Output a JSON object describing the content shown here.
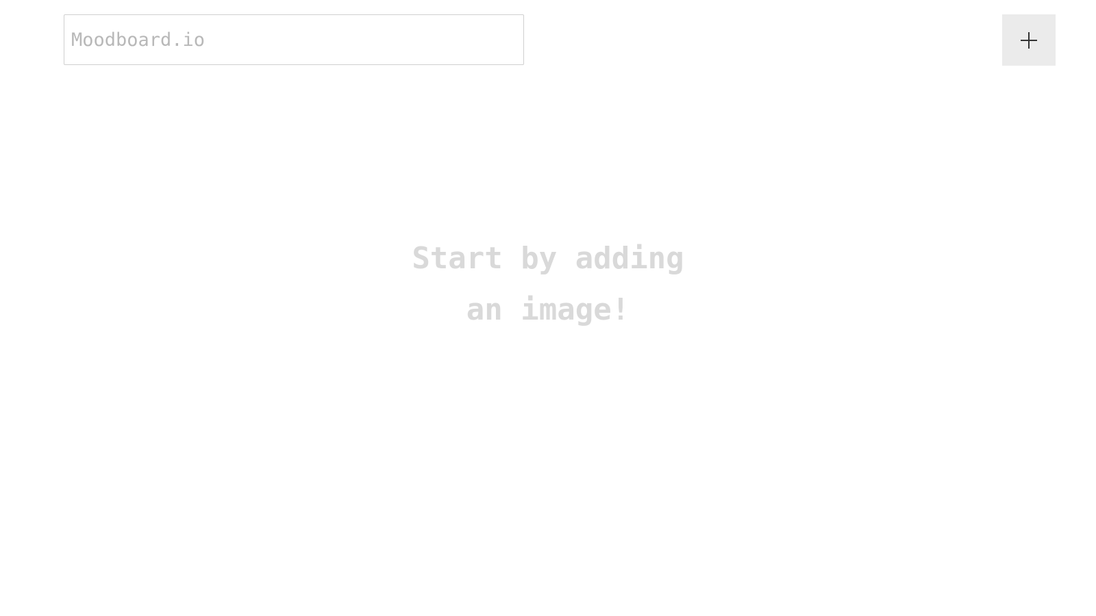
{
  "header": {
    "title_input": {
      "value": "",
      "placeholder": "Moodboard.io"
    },
    "add_button": {
      "icon": "plus-icon"
    }
  },
  "empty_state": {
    "line1": "Start by adding",
    "line2": "an image!"
  },
  "colors": {
    "background": "#ffffff",
    "placeholder_text": "#b8b8b8",
    "empty_state_text": "#d9d9d9",
    "button_background": "#ebebeb",
    "icon_stroke": "#333333",
    "input_border": "#cfcfcf"
  }
}
